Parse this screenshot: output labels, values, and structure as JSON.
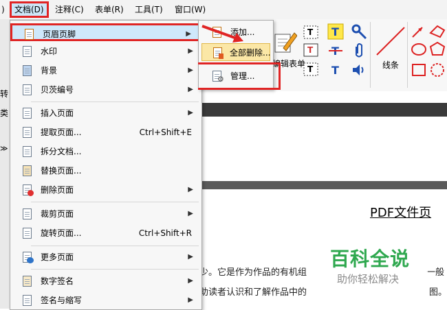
{
  "menubar": {
    "items": [
      "文档(D)",
      "注释(C)",
      "表单(R)",
      "工具(T)",
      "窗口(W)"
    ]
  },
  "toolbar": {
    "label_form": "编辑表单",
    "label_line": "线条"
  },
  "document": {
    "heading": "PDF文件页",
    "line1": "少。它是作为作品的有机组",
    "line1_end": "一般",
    "line2": "助读者认识和了解作品中的",
    "line2_end": "图。"
  },
  "left_fragments": [
    "转",
    "类",
    "≫"
  ],
  "menu": {
    "items": [
      {
        "label": "页眉页脚",
        "shortcut": "",
        "submenu": true
      },
      {
        "label": "水印",
        "shortcut": "",
        "submenu": true
      },
      {
        "label": "背景",
        "shortcut": "",
        "submenu": true
      },
      {
        "label": "贝茨编号",
        "shortcut": "",
        "submenu": true
      },
      {
        "label": "插入页面",
        "shortcut": "",
        "submenu": true
      },
      {
        "label": "提取页面...",
        "shortcut": "Ctrl+Shift+E",
        "submenu": false
      },
      {
        "label": "拆分文档...",
        "shortcut": "",
        "submenu": false
      },
      {
        "label": "替换页面...",
        "shortcut": "",
        "submenu": false
      },
      {
        "label": "删除页面",
        "shortcut": "",
        "submenu": true
      },
      {
        "label": "裁剪页面",
        "shortcut": "",
        "submenu": true
      },
      {
        "label": "旋转页面...",
        "shortcut": "Ctrl+Shift+R",
        "submenu": false
      },
      {
        "label": "更多页面",
        "shortcut": "",
        "submenu": true
      },
      {
        "label": "数字签名",
        "shortcut": "",
        "submenu": true
      },
      {
        "label": "签名与缩写",
        "shortcut": "",
        "submenu": true
      }
    ]
  },
  "submenu": {
    "items": [
      {
        "label": "添加..."
      },
      {
        "label": "全部删除..."
      },
      {
        "label": "管理..."
      }
    ]
  },
  "watermark": {
    "title": "百科全说",
    "subtitle": "助你轻松解决"
  },
  "colors": {
    "highlight_border": "#e02424",
    "menu_hover": "#cfe8fb",
    "submenu_selected": "#fbe7a6",
    "watermark_green": "#2fa84f"
  }
}
